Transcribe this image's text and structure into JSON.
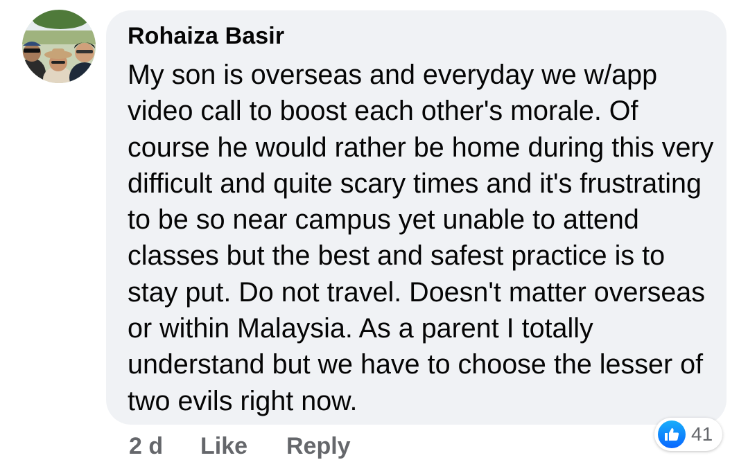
{
  "comment": {
    "author": "Rohaiza Basir",
    "text": "My son is overseas and everyday we w/app video call to boost each other's morale. Of course he would rather be home during this very difficult and quite scary times and it's frustrating to be so near campus yet unable to attend classes but the best and safest practice is to stay put. Do not travel. Doesn't matter overseas or within Malaysia. As a parent I totally understand but we have to choose the lesser of two evils right now.",
    "timestamp": "2 d",
    "like_label": "Like",
    "reply_label": "Reply",
    "reactions": {
      "icon": "thumbs-up-icon",
      "count": "41"
    }
  },
  "colors": {
    "bubble_background": "#f0f2f5",
    "text": "#050505",
    "meta_text": "#65676b",
    "like_blue": "#0866ff"
  }
}
